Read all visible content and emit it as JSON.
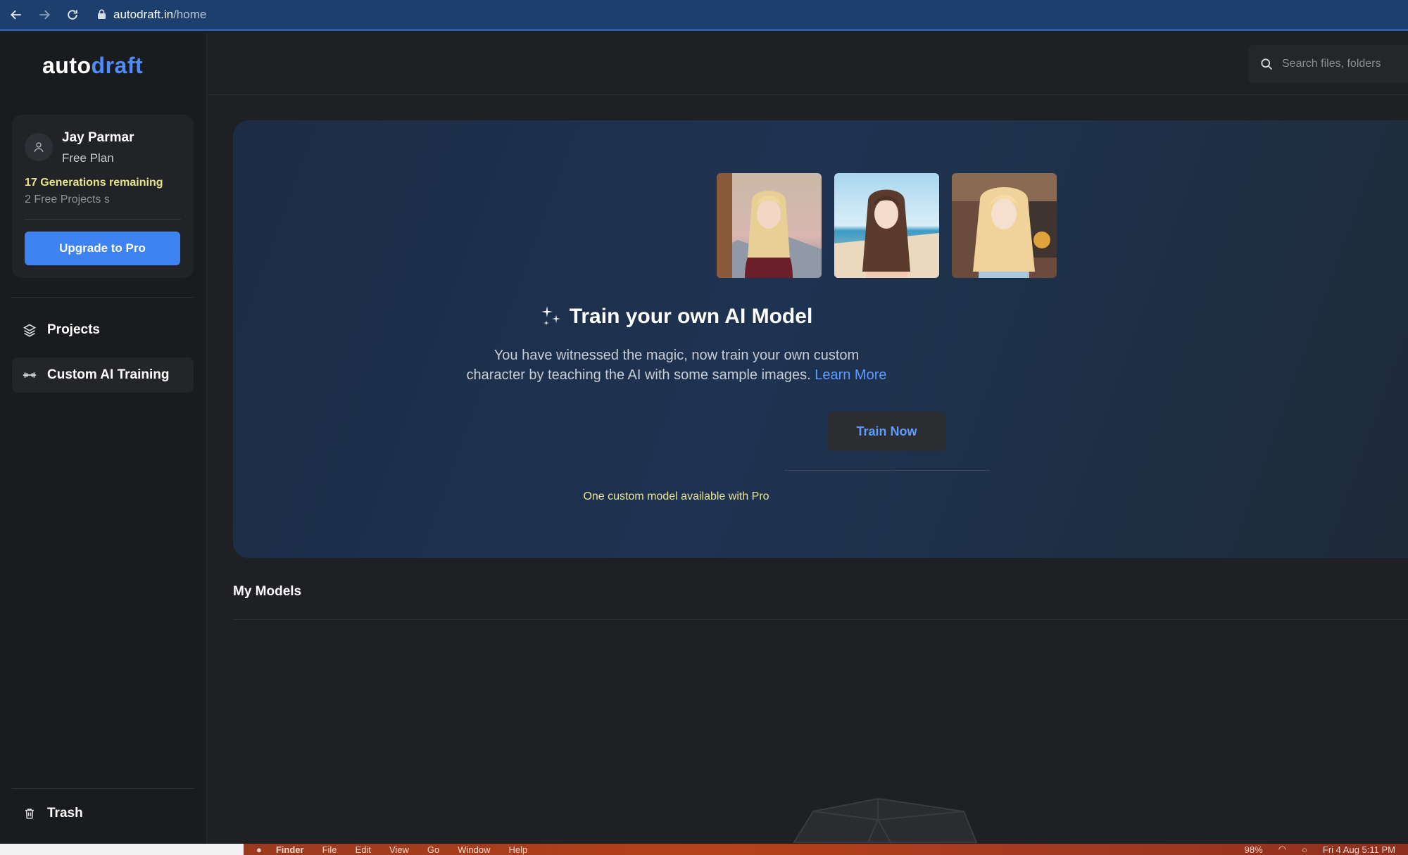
{
  "browser": {
    "url_host": "autodraft.in",
    "url_path": "/home"
  },
  "logo": {
    "part1": "auto",
    "part2": "draft"
  },
  "account": {
    "name": "Jay Parmar",
    "plan": "Free Plan",
    "generations": "17 Generations remaining",
    "projects": "2 Free Projects s",
    "upgrade_label": "Upgrade to Pro"
  },
  "nav": {
    "projects": "Projects",
    "custom_training": "Custom AI Training",
    "trash": "Trash"
  },
  "search": {
    "placeholder": "Search files, folders"
  },
  "hero": {
    "title": "Train your own AI Model",
    "desc_line": "You have witnessed the magic, now train your own custom character by teaching the AI with some sample images.",
    "learn_more": "Learn More",
    "train_label": "Train Now",
    "pro_note": "One custom model available with Pro"
  },
  "models": {
    "title": "My Models"
  },
  "os_bar": {
    "items": [
      "Finder",
      "File",
      "Edit",
      "View",
      "Go",
      "Window",
      "Help"
    ],
    "battery": "98%",
    "clock": "Fri 4 Aug  5:11 PM"
  },
  "colors": {
    "accent": "#3f82f1",
    "link": "#5b9bff",
    "highlight": "#e5e48a"
  }
}
